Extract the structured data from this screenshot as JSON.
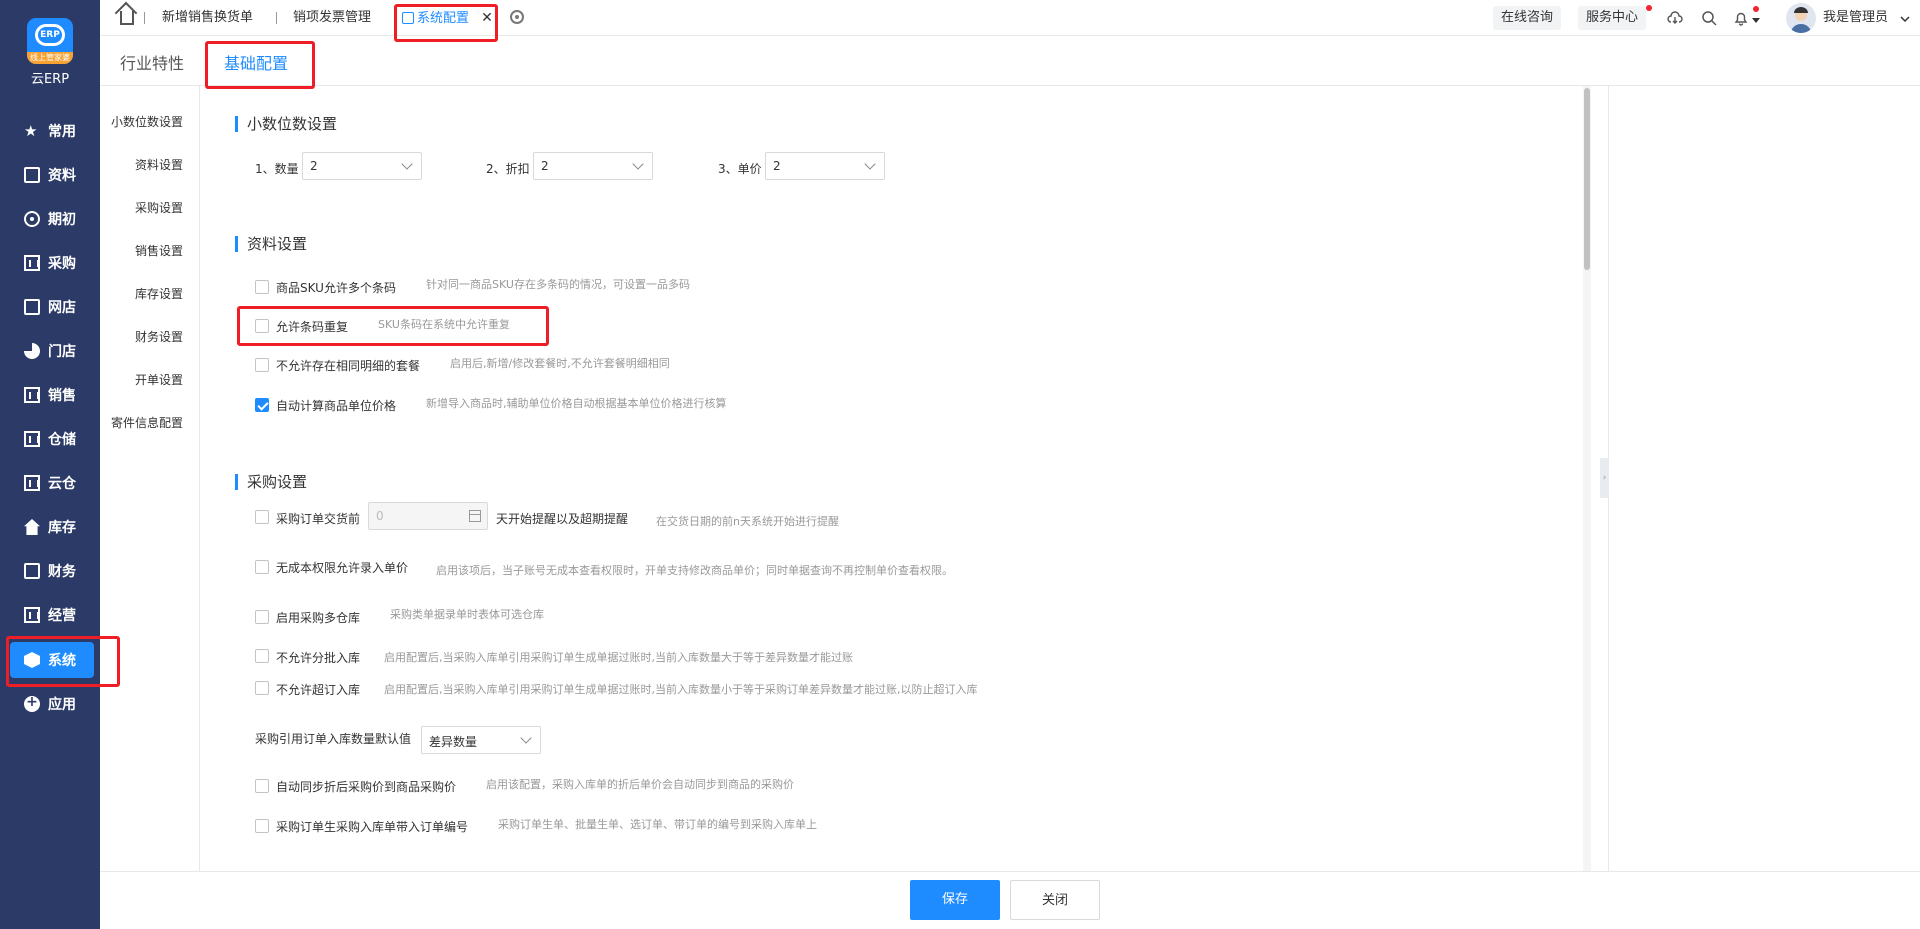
{
  "sidebar": {
    "logo_strip": "线上管家婆",
    "logo_badge": "ERP",
    "logo_name": "云ERP",
    "items": [
      {
        "label": "常用",
        "icon": "star-icon"
      },
      {
        "label": "资料",
        "icon": "document-icon"
      },
      {
        "label": "期初",
        "icon": "target-icon"
      },
      {
        "label": "采购",
        "icon": "purchase-icon"
      },
      {
        "label": "网店",
        "icon": "store-icon"
      },
      {
        "label": "门店",
        "icon": "pie-chart-icon"
      },
      {
        "label": "销售",
        "icon": "bar-chart-icon"
      },
      {
        "label": "仓储",
        "icon": "warehouse-icon"
      },
      {
        "label": "云仓",
        "icon": "cloud-warehouse-icon"
      },
      {
        "label": "库存",
        "icon": "home-icon"
      },
      {
        "label": "财务",
        "icon": "finance-icon"
      },
      {
        "label": "经营",
        "icon": "business-icon"
      },
      {
        "label": "系统",
        "icon": "system-icon"
      },
      {
        "label": "应用",
        "icon": "plus-circle-icon"
      }
    ],
    "active": "系统"
  },
  "topbar": {
    "tabs": [
      {
        "label": "新增销售换货单"
      },
      {
        "label": "销项发票管理"
      },
      {
        "label": "系统配置"
      }
    ],
    "online_consult": "在线咨询",
    "service_center": "服务中心",
    "user_name": "我是管理员"
  },
  "subtabs": {
    "industry": "行业特性",
    "basic": "基础配置"
  },
  "section_nav": [
    "小数位数设置",
    "资料设置",
    "采购设置",
    "销售设置",
    "库存设置",
    "财务设置",
    "开单设置",
    "寄件信息配置"
  ],
  "decimal": {
    "title": "小数位数设置",
    "quantity_label": "1、数量",
    "quantity_value": "2",
    "discount_label": "2、折扣",
    "discount_value": "2",
    "price_label": "3、单价",
    "price_value": "2"
  },
  "data_settings": {
    "title": "资料设置",
    "options": [
      {
        "label": "商品SKU允许多个条码",
        "hint": "针对同一商品SKU存在多条码的情况，可设置一品多码",
        "checked": false
      },
      {
        "label": "允许条码重复",
        "hint": "SKU条码在系统中允许重复",
        "checked": false
      },
      {
        "label": "不允许存在相同明细的套餐",
        "hint": "启用后,新增/修改套餐时,不允许套餐明细相同",
        "checked": false
      },
      {
        "label": "自动计算商品单位价格",
        "hint": "新增导入商品时,辅助单位价格自动根据基本单位价格进行核算",
        "checked": true
      }
    ]
  },
  "purchase_settings": {
    "title": "采购设置",
    "remind": {
      "label": "采购订单交货前",
      "value": "0",
      "suffix": "天开始提醒以及超期提醒",
      "hint": "在交货日期的前n天系统开始进行提醒"
    },
    "options": [
      {
        "label": "无成本权限允许录入单价",
        "hint": "启用该项后，当子账号无成本查看权限时，开单支持修改商品单价；同时单据查询不再控制单价查看权限。",
        "checked": false
      },
      {
        "label": "启用采购多仓库",
        "hint": "采购类单据录单时表体可选仓库",
        "checked": false
      },
      {
        "label": "不允许分批入库",
        "hint": "启用配置后,当采购入库单引用采购订单生成单据过账时,当前入库数量大于等于差异数量才能过账",
        "checked": false
      },
      {
        "label": "不允许超订入库",
        "hint": "启用配置后,当采购入库单引用采购订单生成单据过账时,当前入库数量小于等于采购订单差异数量才能过账,以防止超订入库",
        "checked": false
      }
    ],
    "default_qty_label": "采购引用订单入库数量默认值",
    "default_qty_value": "差异数量",
    "options2": [
      {
        "label": "自动同步折后采购价到商品采购价",
        "hint": "启用该配置，采购入库单的折后单价会自动同步到商品的采购价",
        "checked": false
      },
      {
        "label": "采购订单生采购入库单带入订单编号",
        "hint": "采购订单生单、批量生单、选订单、带订单的编号到采购入库单上",
        "checked": false
      }
    ]
  },
  "footer": {
    "save": "保存",
    "close": "关闭"
  },
  "colors": {
    "sidebar_bg": "#2b3a67",
    "accent": "#1e8cff",
    "highlight": "#ef1d26"
  }
}
